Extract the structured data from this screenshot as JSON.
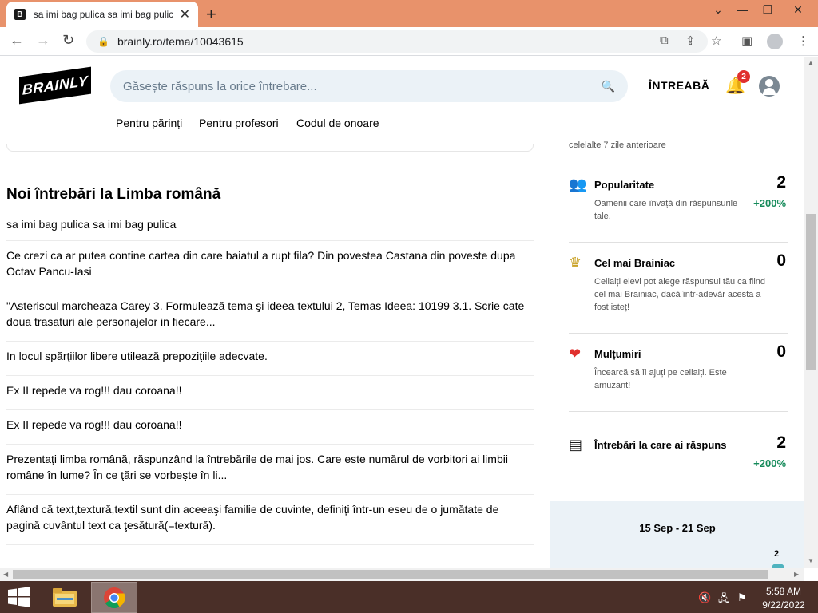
{
  "browser": {
    "tab_title": "sa imi bag pulica sa imi bag pulica",
    "tab_favicon": "B",
    "new_tab_icon": "+",
    "url": "brainly.ro/tema/10043615",
    "window_controls": [
      "⌄",
      "—",
      "❐",
      "✕"
    ]
  },
  "brainly": {
    "logo_text": "BRAINLY",
    "search_placeholder": "Găsește răspuns la orice întrebare...",
    "ask_label": "ÎNTREABĂ",
    "notification_count": "2",
    "nav_links": [
      "Pentru părinți",
      "Pentru profesori",
      "Codul de onoare"
    ]
  },
  "main": {
    "section_title": "Noi întrebări la Limba română",
    "questions": [
      "sa imi bag pulica sa imi bag pulica",
      "Ce crezi ca ar putea contine cartea din care baiatul a rupt fila? Din povestea Castana din poveste dupa Octav Pancu-Iasi",
      "\"Asteriscul marcheaza Carey 3. Formulează tema şi ideea textului 2, Temas Ideea: 10199 3.1. Scrie cate doua trasaturi ale personajelor in fiecare...",
      "In locul spărţiilor libere utilează prepoziţiile adecvate.",
      "Ex II repede va rog!!! dau coroana!!",
      "Ex II repede va rog!!! dau coroana!!",
      "Prezentați limba română, răspunzând la întrebările de mai jos. Care este numărul de vorbitori ai limbii române în lume? În ce ţări se vorbeşte în li...",
      "Aflând că text,textură,textil sunt din aceeaşi familie de cuvinte, definiți într-un eseu de o jumătate de pagină cuvântul text ca ţesătură(=textură)."
    ]
  },
  "sidebar": {
    "cut_text": "celelalte 7 zile anterioare",
    "stats": [
      {
        "name": "Popularitate",
        "value": "2",
        "description": "Oamenii care învață din răspunsurile tale.",
        "change": "+200%",
        "icon": "people-icon",
        "color": "#1e88e5"
      },
      {
        "name": "Cel mai Brainiac",
        "value": "0",
        "description": "Ceilalți elevi pot alege răspunsul tău ca fiind cel mai Brainiac, dacă într-adevăr acesta a fost isteț!",
        "change": "",
        "icon": "crown-icon",
        "color": "#c9a227"
      },
      {
        "name": "Mulțumiri",
        "value": "0",
        "description": "Încearcă să îi ajuți pe ceilalți. Este amuzant!",
        "change": "",
        "icon": "heart-icon",
        "color": "#e0302e"
      },
      {
        "name": "Întrebări la care ai răspuns",
        "value": "2",
        "description": "",
        "change": "+200%",
        "icon": "answers-icon",
        "color": "#1a1a1a"
      }
    ],
    "week_range": "15 Sep - 21 Sep",
    "week_value": "2"
  },
  "taskbar": {
    "time": "5:58 AM",
    "date": "9/22/2022"
  }
}
